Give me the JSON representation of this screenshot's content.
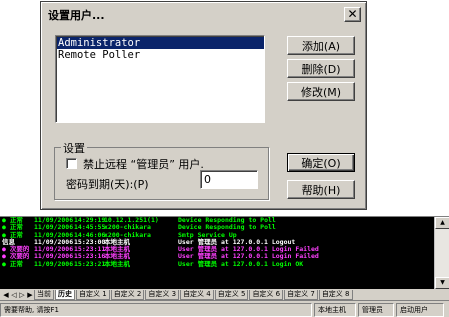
{
  "dialog": {
    "title": "设置用户...",
    "close_glyph": "✕",
    "users": [
      "Administrator",
      "Remote Poller"
    ],
    "selected_index": 0,
    "add_button": "添加(A)",
    "delete_button": "删除(D)",
    "modify_button": "修改(M)",
    "ok_button": "确定(O)",
    "help_button": "帮助(H)",
    "settings_group": "设置",
    "disable_remote_label": "禁止远程 “管理员” 用户.",
    "disable_remote_checked": false,
    "password_expiry_label": "密码到期(天):(P)",
    "password_expiry_value": "0"
  },
  "log": {
    "rows": [
      {
        "status": "● 正常",
        "date": "11/09/2006",
        "time": "14:29:19",
        "source": "10.12.1.251(1)",
        "message": "Device Responding to Poll",
        "color": "#00ff00"
      },
      {
        "status": "● 正常",
        "date": "11/09/2006",
        "time": "14:45:55",
        "source": "x200-chikara",
        "message": "Device Responding to Poll",
        "color": "#00ff00"
      },
      {
        "status": "● 正常",
        "date": "11/09/2006",
        "time": "14:46:06",
        "source": "x200-chikara",
        "message": "Smtp Service Up",
        "color": "#00ff00"
      },
      {
        "status": "  信息",
        "date": "11/09/2006",
        "time": "15:23:00",
        "source": "本地主机",
        "message": "User 管理员 at 127.0.0.1 Logout",
        "color": "#ffffff"
      },
      {
        "status": "● 次要的",
        "date": "11/09/2006",
        "time": "15:23:11",
        "source": "本地主机",
        "message": "User 管理员 at 127.0.0.1 Login Failed",
        "color": "#ff40ff"
      },
      {
        "status": "● 次要的",
        "date": "11/09/2006",
        "time": "15:23:16",
        "source": "本地主机",
        "message": "User 管理员 at 127.0.0.1 Login Failed",
        "color": "#ff40ff"
      },
      {
        "status": "● 正常",
        "date": "11/09/2006",
        "time": "15:23:21",
        "source": "本地主机",
        "message": "User 管理员 at 127.0.0.1 Login OK",
        "color": "#00ff00"
      }
    ],
    "tabs": [
      "当前",
      "历史",
      "自定义 1",
      "自定义 2",
      "自定义 3",
      "自定义 4",
      "自定义 5",
      "自定义 6",
      "自定义 7",
      "自定义 8"
    ],
    "active_tab": 1,
    "status_hint": "需要帮助, 请按F1",
    "status_host": "本地主机",
    "status_user": "管理员",
    "status_mode": "启动用户"
  }
}
